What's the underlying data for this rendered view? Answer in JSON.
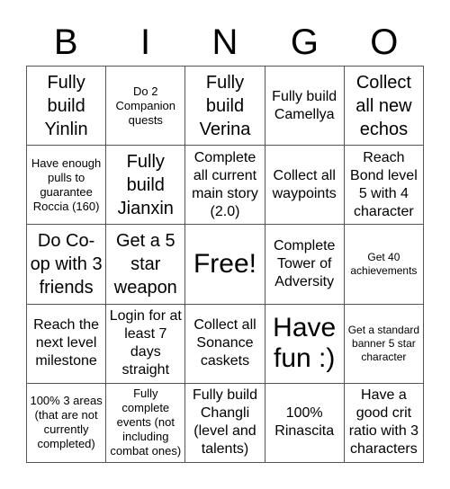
{
  "header": {
    "letters": [
      "B",
      "I",
      "N",
      "G",
      "O"
    ]
  },
  "board": {
    "cells": [
      {
        "text": "Fully build Yinlin",
        "size": "l"
      },
      {
        "text": "Do 2 Companion quests",
        "size": "s"
      },
      {
        "text": "Fully build Verina",
        "size": "l"
      },
      {
        "text": "Fully build Camellya",
        "size": "m"
      },
      {
        "text": "Collect all new echos",
        "size": "l"
      },
      {
        "text": "Have enough pulls to guarantee Roccia (160)",
        "size": "s"
      },
      {
        "text": "Fully build Jianxin",
        "size": "l"
      },
      {
        "text": "Complete all current main story (2.0)",
        "size": "m"
      },
      {
        "text": "Collect all waypoints",
        "size": "m"
      },
      {
        "text": "Reach Bond level 5 with 4 character",
        "size": "m"
      },
      {
        "text": "Do Co-op with 3 friends",
        "size": "l"
      },
      {
        "text": "Get a 5 star weapon",
        "size": "l"
      },
      {
        "text": "Free!",
        "size": "xl"
      },
      {
        "text": "Complete Tower of Adversity",
        "size": "m"
      },
      {
        "text": "Get 40 achievements",
        "size": "xs"
      },
      {
        "text": "Reach the next level milestone",
        "size": "m"
      },
      {
        "text": "Login for at least 7 days straight",
        "size": "m"
      },
      {
        "text": "Collect all Sonance caskets",
        "size": "m"
      },
      {
        "text": "Have fun :)",
        "size": "xl"
      },
      {
        "text": "Get a standard banner 5 star character",
        "size": "xs"
      },
      {
        "text": "100% 3 areas (that are not currently completed)",
        "size": "s"
      },
      {
        "text": "Fully complete events (not including combat ones)",
        "size": "s"
      },
      {
        "text": "Fully build Changli (level and talents)",
        "size": "m"
      },
      {
        "text": "100% Rinascita",
        "size": "m"
      },
      {
        "text": "Have a good crit ratio with 3 characters",
        "size": "m"
      }
    ]
  }
}
